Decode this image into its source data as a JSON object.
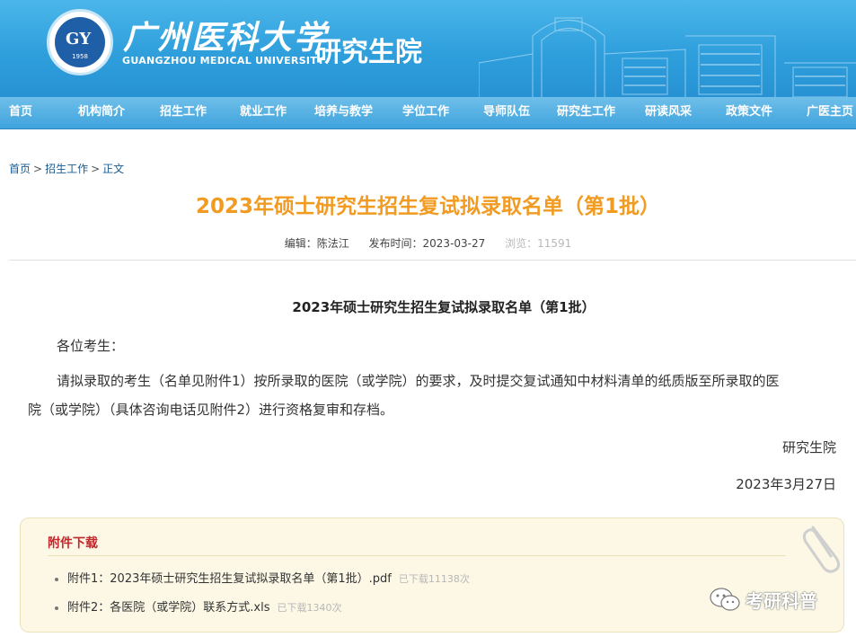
{
  "header": {
    "school_name_cn": "广州医科大学",
    "school_name_en": "GUANGZHOU MEDICAL UNIVERSITY",
    "logo_char": "GY",
    "logo_year": "1958",
    "site_name": "研究生院",
    "brand_color": "#2f9fdc"
  },
  "nav": {
    "items": [
      "首页",
      "机构简介",
      "招生工作",
      "就业工作",
      "培养与教学",
      "学位工作",
      "导师队伍",
      "研究生工作",
      "研读风采",
      "政策文件",
      "广医主页"
    ]
  },
  "breadcrumb": {
    "home": "首页",
    "sep1": ">",
    "section": "招生工作",
    "sep2": ">",
    "current": "正文"
  },
  "article": {
    "headline": "2023年硕士研究生招生复试拟录取名单（第1批）",
    "meta": {
      "editor": "编辑：陈法江",
      "published": "发布时间：2023-03-27",
      "views": "浏览：11591"
    },
    "title": "2023年硕士研究生招生复试拟录取名单（第1批）",
    "greeting": "各位考生：",
    "body_line1": "请拟录取的考生（名单见附件1）按所录取的医院（或学院）的要求，及时提交复试通知中材料清单的纸质版至所录取的医",
    "body_line2": "院（或学院）（具体咨询电话见附件2）进行资格复审和存档。",
    "signature": "研究生院",
    "date": "2023年3月27日"
  },
  "attachments": {
    "heading": "附件下载",
    "items": [
      {
        "name": "附件1：2023年硕士研究生招生复试拟录取名单（第1批）.pdf",
        "count": "已下载11138次"
      },
      {
        "name": "附件2：各医院（或学院）联系方式.xls",
        "count": "已下载1340次"
      }
    ]
  },
  "watermark": {
    "text": "考研科普"
  }
}
